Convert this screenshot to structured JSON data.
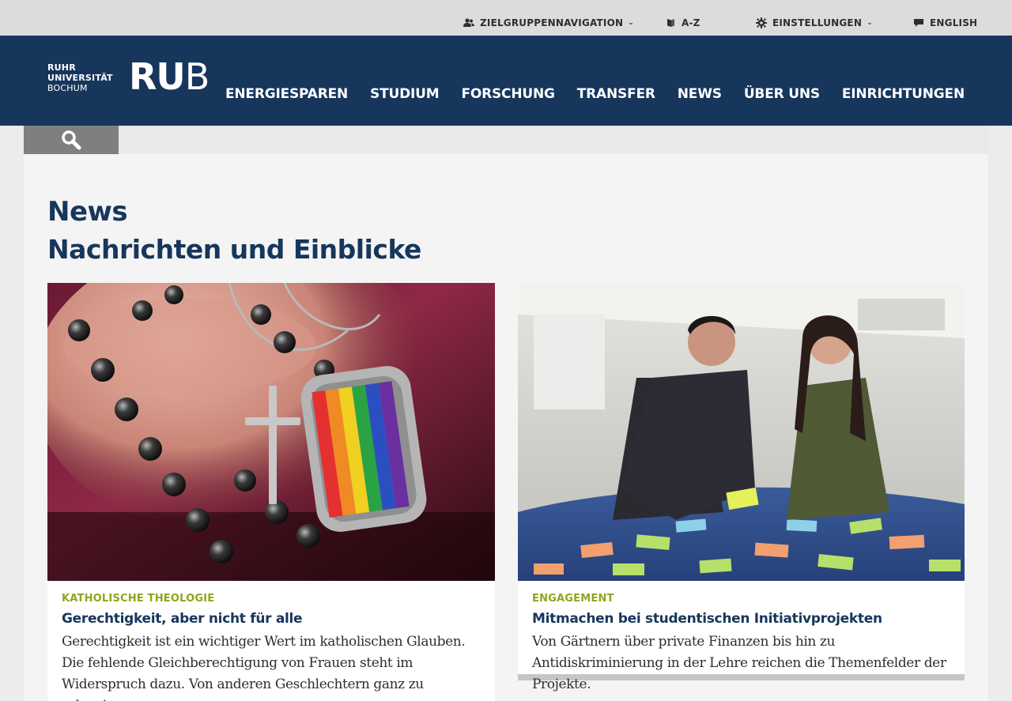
{
  "utility_nav": {
    "audience": "ZIELGRUPPENNAVIGATION",
    "az": "A-Z",
    "settings": "EINSTELLUNGEN",
    "language": "ENGLISH"
  },
  "logo": {
    "line1": "RUHR",
    "line2": "UNIVERSITÄT",
    "line3": "BOCHUM",
    "mark_bold": "RU",
    "mark_thin": "B"
  },
  "main_nav": {
    "items": [
      "ENERGIESPAREN",
      "STUDIUM",
      "FORSCHUNG",
      "TRANSFER",
      "NEWS",
      "ÜBER UNS",
      "EINRICHTUNGEN"
    ]
  },
  "page": {
    "title": "News",
    "subtitle": "Nachrichten und Einblicke"
  },
  "cards": [
    {
      "kicker": "KATHOLISCHE THEOLOGIE",
      "headline": "Gerechtigkeit, aber nicht für alle",
      "teaser": "Gerechtigkeit ist ein wichtiger Wert im katholischen Glauben. Die fehlende Gleichberechtigung von Frauen steht im Widerspruch dazu. Von anderen Geschlechtern ganz zu schweigen."
    },
    {
      "kicker": "ENGAGEMENT",
      "headline": "Mitmachen bei studentischen Initiativprojekten",
      "teaser": "Von Gärtnern über private Finanzen bis hin zu Antidiskriminierung in der Lehre reichen die Themenfelder der Projekte."
    }
  ],
  "colors": {
    "brand_blue": "#17365c",
    "accent_green": "#8aa81b",
    "topbar_bg": "#dcdcdc",
    "search_button": "#7f7f7f"
  },
  "icons": {
    "audience": "users-icon",
    "az": "book-icon",
    "settings": "gear-icon",
    "language": "speech-bubble-icon",
    "search": "search-icon",
    "dropdown": "chevron-down-icon"
  }
}
